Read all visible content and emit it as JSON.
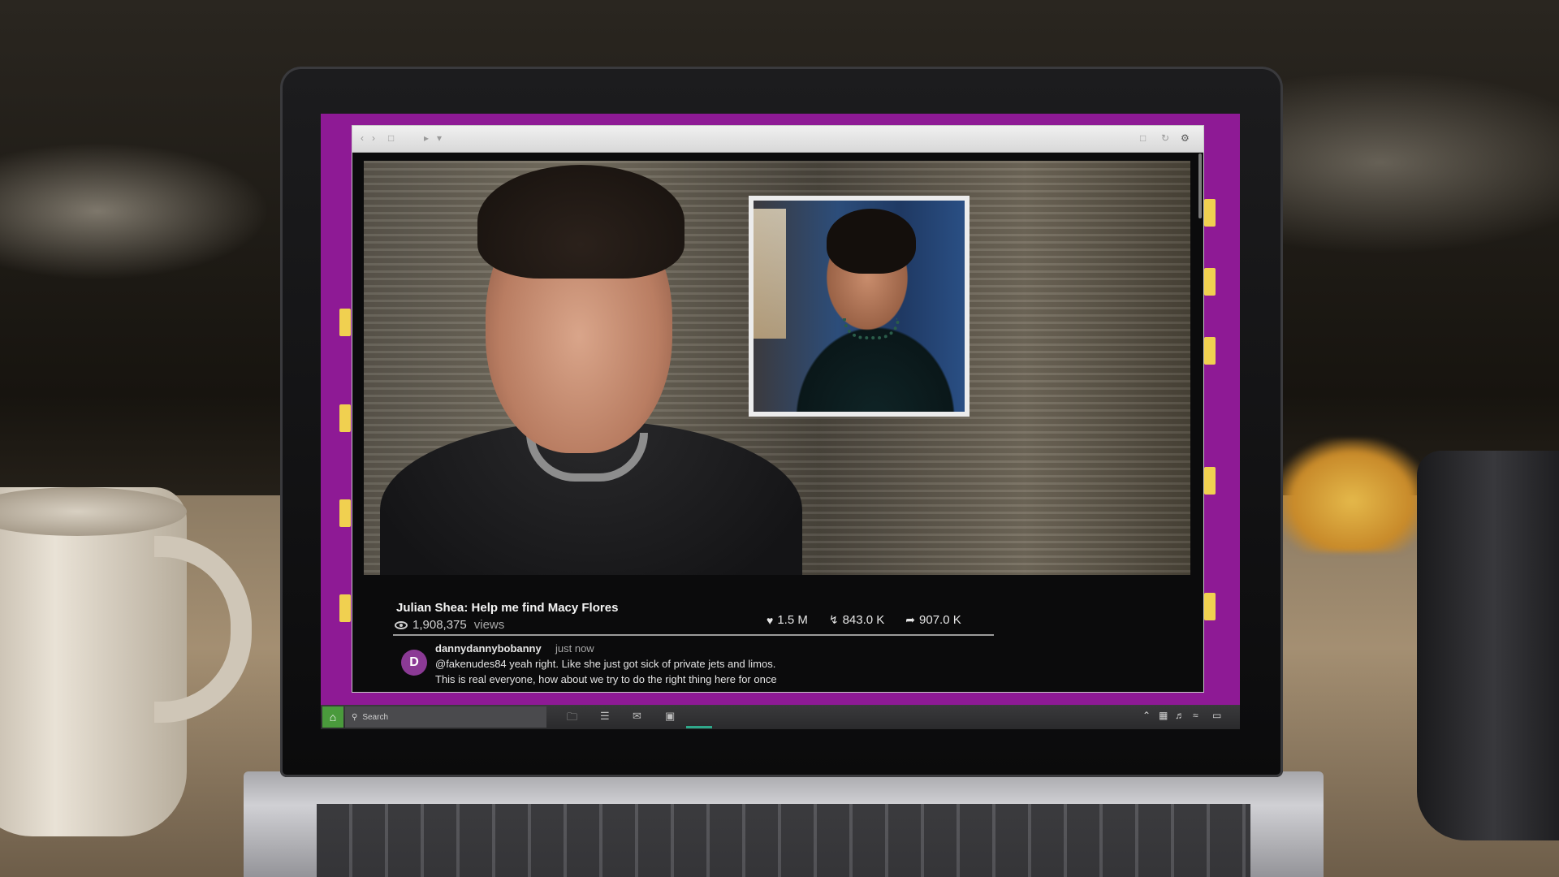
{
  "video": {
    "title": "Julian Shea: Help me find Macy Flores",
    "views": "1,908,375",
    "views_label": "views",
    "likes": "1.5 M",
    "reposts": "843.0 K",
    "shares": "907.0 K"
  },
  "comments": [
    {
      "avatar_letter": "D",
      "user": "dannydannybobanny",
      "time": "just now",
      "lines": [
        "@fakenudes84 yeah right.  Like she just got sick of private jets and limos.",
        "This is real everyone, how about we try to do the right thing here for once"
      ]
    }
  ],
  "taskbar": {
    "search_label": "Search"
  },
  "colors": {
    "desktop_bg": "#8e1a95",
    "taskbar_accent": "#2fa88a",
    "start_button": "#4a9a3c"
  },
  "icons": {
    "views": "eye-icon",
    "likes": "heart-icon",
    "reposts": "repost-icon",
    "shares": "share-arrow-icon"
  }
}
